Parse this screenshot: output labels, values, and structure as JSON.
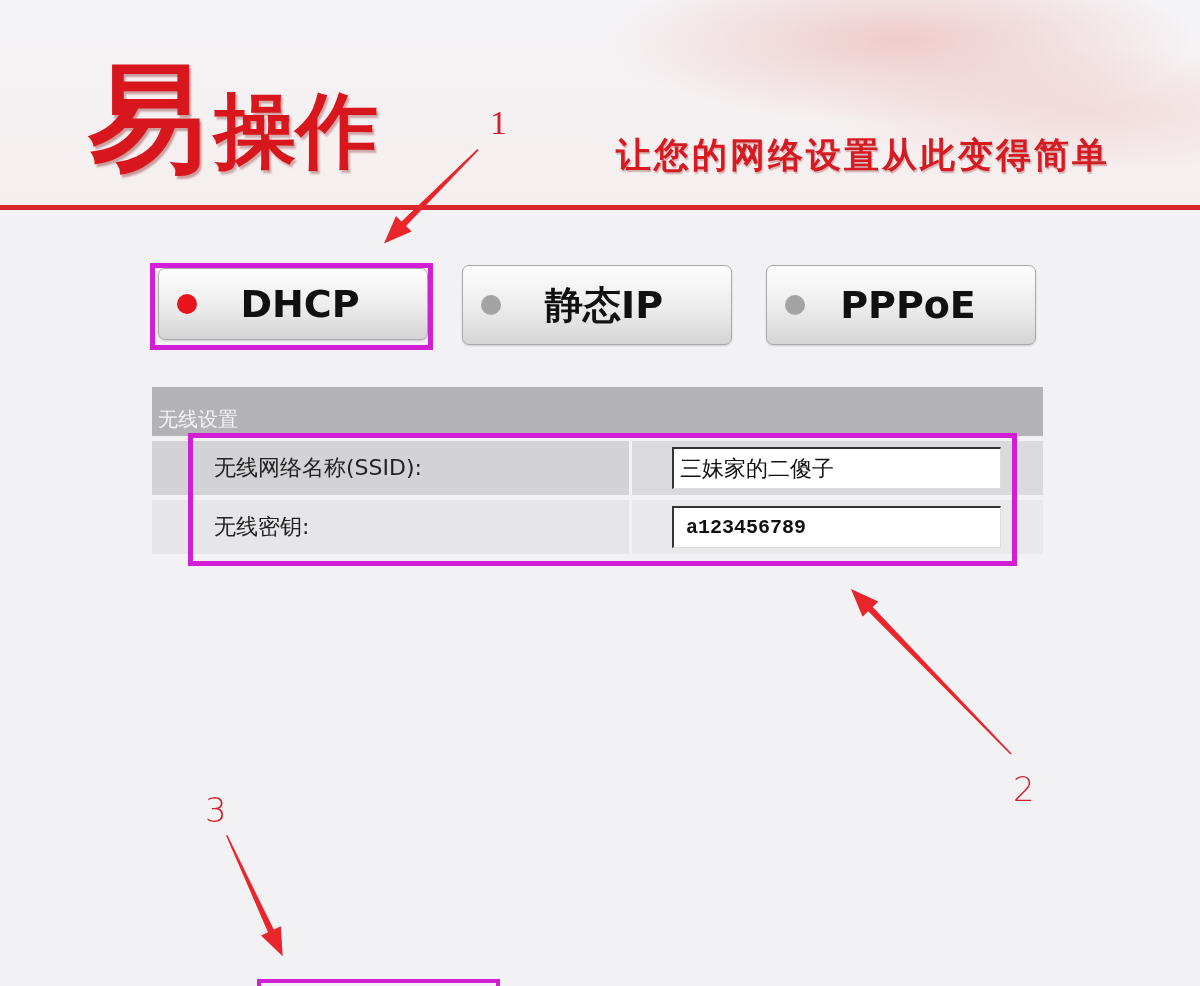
{
  "header": {
    "logo_mark": "易",
    "logo_text": "操作",
    "slogan": "让您的网络设置从此变得简单"
  },
  "modes": [
    {
      "label": "DHCP",
      "selected": true
    },
    {
      "label": "静态IP",
      "selected": false
    },
    {
      "label": "PPPoE",
      "selected": false
    }
  ],
  "wireless": {
    "title": "无线设置",
    "fields": [
      {
        "kind": "text",
        "label": "无线网络名称(SSID):",
        "value": "三妹家的二傻子"
      },
      {
        "kind": "key",
        "label": "无线密钥:",
        "value": "a123456789"
      }
    ]
  },
  "annotations": [
    {
      "number": "1"
    },
    {
      "number": "2"
    },
    {
      "number": "3"
    }
  ]
}
